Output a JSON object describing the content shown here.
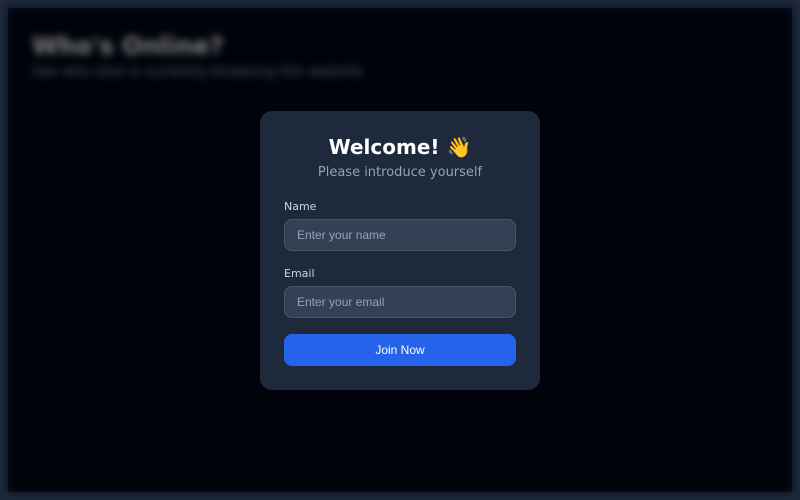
{
  "background": {
    "title": "Who's Online?",
    "subtitle": "See who else is currently browsing this website"
  },
  "modal": {
    "title": "Welcome! 👋",
    "subtitle": "Please introduce yourself",
    "fields": {
      "name": {
        "label": "Name",
        "placeholder": "Enter your name"
      },
      "email": {
        "label": "Email",
        "placeholder": "Enter your email"
      }
    },
    "submit_label": "Join Now"
  }
}
